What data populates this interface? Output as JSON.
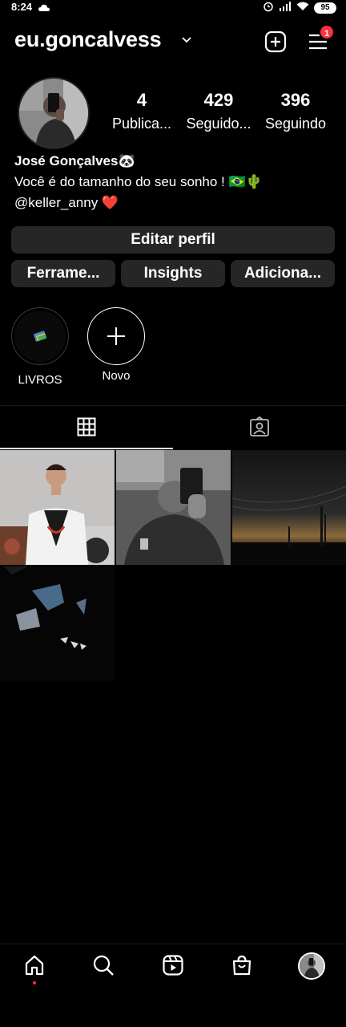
{
  "status_bar": {
    "time": "8:24",
    "battery": "95",
    "icons": [
      "cloud-icon",
      "alarm-icon",
      "signal-icon",
      "wifi-icon",
      "battery-icon"
    ]
  },
  "header": {
    "username": "eu.goncalvess",
    "menu_badge": "1",
    "icons": [
      "chevron-down-icon",
      "new-post-icon",
      "menu-icon"
    ]
  },
  "profile": {
    "stats": [
      {
        "count": "4",
        "label": "Publica..."
      },
      {
        "count": "429",
        "label": "Seguido..."
      },
      {
        "count": "396",
        "label": "Seguindo"
      }
    ],
    "name": "José Gonçalves🐼",
    "bio_line": "Você é do tamanho do seu sonho ! 🇧🇷🌵",
    "mention_line": "@keller_anny ❤️"
  },
  "buttons": {
    "edit_profile": "Editar perfil",
    "tools": "Ferrame...",
    "insights": "Insights",
    "add": "Adiciona..."
  },
  "highlights": [
    {
      "label": "LIVROS"
    },
    {
      "label": "Novo"
    }
  ],
  "tabs": [
    "grid-icon",
    "tagged-icon"
  ],
  "posts": [
    "post-1",
    "post-2",
    "post-3",
    "post-4"
  ],
  "bottom_nav": [
    "home-icon",
    "search-icon",
    "reels-icon",
    "shop-icon",
    "profile-avatar"
  ],
  "colors": {
    "background": "#000000",
    "button": "#262626",
    "badge": "#ff3040"
  }
}
